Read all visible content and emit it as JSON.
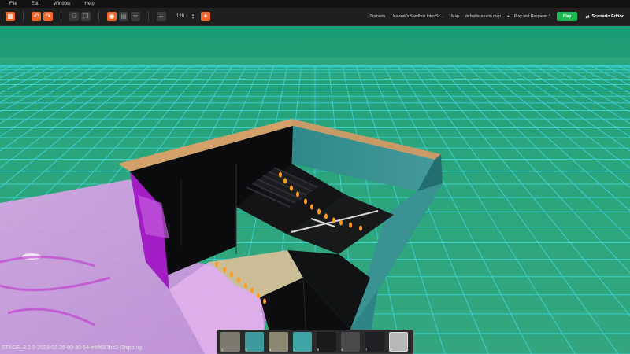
{
  "menu": [
    "File",
    "Edit",
    "Window",
    "Help"
  ],
  "toolbar": {
    "grid_size": "128",
    "scenario_label": "Scenario",
    "scenario_value": "Kovaak's Sandbox Intro Sc...",
    "map_label": "Map",
    "map_value": "defaultscenario.map",
    "play_mode": "Play and Respawn",
    "play_label": "Play",
    "editor_label": "Scenario Editor"
  },
  "status": {
    "build": "STAGE_3.2.0-2023-02-28-09-30-54-e6ff687bb2-Shipping"
  },
  "hotbar": {
    "slots": [
      "1",
      "2",
      "3",
      "4",
      "5",
      "6",
      "7",
      "8"
    ]
  },
  "colors": {
    "accent": "#f2672a",
    "play": "#1db954",
    "sky": "#21a179",
    "grid": "#3fd6de",
    "wall_teal": "#3e8f90",
    "floor_tan": "#cbbe96",
    "magenta_wall": "#a21ec4"
  }
}
